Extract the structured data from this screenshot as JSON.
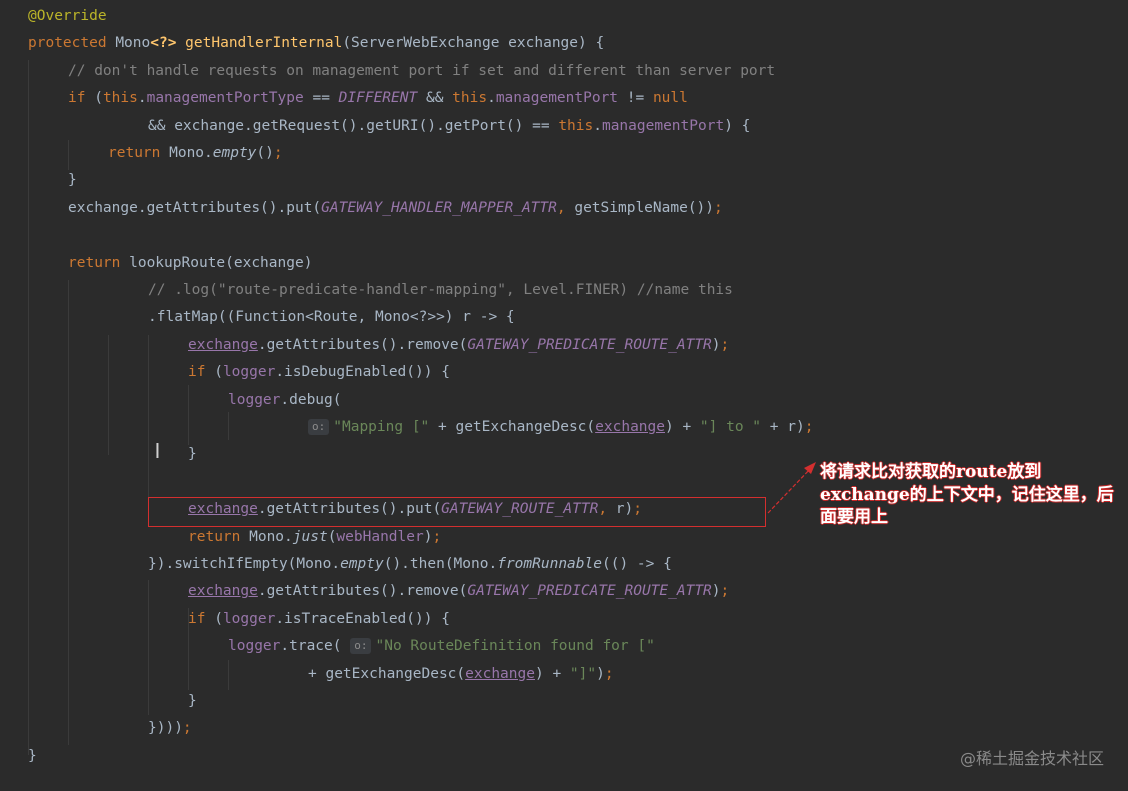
{
  "colors": {
    "background": "#2b2b2b",
    "keyword": "#cc7832",
    "plain": "#a9b7c6",
    "comment": "#808080",
    "string": "#6a8759",
    "field": "#9876aa",
    "method": "#ffc66d",
    "annotation": "#bbb529",
    "highlight_box": "#d32f2f"
  },
  "code_lines": [
    {
      "tokens": [
        {
          "t": "@Override",
          "c": "annotation"
        }
      ]
    },
    {
      "tokens": [
        {
          "t": "protected ",
          "c": "keyword"
        },
        {
          "t": "Mono",
          "c": "plain"
        },
        {
          "t": "<?>",
          "c": "brace"
        },
        {
          "t": " ",
          "c": "plain"
        },
        {
          "t": "getHandlerInternal",
          "c": "method"
        },
        {
          "t": "(ServerWebExchange exchange) {",
          "c": "plain"
        }
      ]
    },
    {
      "tokens": [
        {
          "t": "// don't handle requests on management port if set and different than server port",
          "c": "comment"
        }
      ]
    },
    {
      "tokens": [
        {
          "t": "if ",
          "c": "keyword"
        },
        {
          "t": "(",
          "c": "plain"
        },
        {
          "t": "this",
          "c": "keyword"
        },
        {
          "t": ".",
          "c": "plain"
        },
        {
          "t": "managementPortType",
          "c": "field"
        },
        {
          "t": " == ",
          "c": "plain"
        },
        {
          "t": "DIFFERENT",
          "c": "static"
        },
        {
          "t": " && ",
          "c": "plain"
        },
        {
          "t": "this",
          "c": "keyword"
        },
        {
          "t": ".",
          "c": "plain"
        },
        {
          "t": "managementPort",
          "c": "field"
        },
        {
          "t": " != ",
          "c": "plain"
        },
        {
          "t": "null",
          "c": "keyword"
        }
      ]
    },
    {
      "tokens": [
        {
          "t": "&& exchange.getRequest().getURI().getPort() == ",
          "c": "plain"
        },
        {
          "t": "this",
          "c": "keyword"
        },
        {
          "t": ".",
          "c": "plain"
        },
        {
          "t": "managementPort",
          "c": "field"
        },
        {
          "t": ") {",
          "c": "plain"
        }
      ]
    },
    {
      "tokens": [
        {
          "t": "return ",
          "c": "keyword"
        },
        {
          "t": "Mono.",
          "c": "plain"
        },
        {
          "t": "empty",
          "c": "italic"
        },
        {
          "t": "()",
          "c": "plain"
        },
        {
          "t": ";",
          "c": "keyword"
        }
      ]
    },
    {
      "tokens": [
        {
          "t": "}",
          "c": "plain"
        }
      ]
    },
    {
      "tokens": [
        {
          "t": "exchange.getAttributes().put(",
          "c": "plain"
        },
        {
          "t": "GATEWAY_HANDLER_MAPPER_ATTR",
          "c": "static"
        },
        {
          "t": ", ",
          "c": "keyword"
        },
        {
          "t": "getSimpleName())",
          "c": "plain"
        },
        {
          "t": ";",
          "c": "keyword"
        }
      ]
    },
    {
      "tokens": []
    },
    {
      "tokens": [
        {
          "t": "return ",
          "c": "keyword"
        },
        {
          "t": "lookupRoute(exchange)",
          "c": "plain"
        }
      ]
    },
    {
      "tokens": [
        {
          "t": "// .log(\"route-predicate-handler-mapping\", Level.FINER) //name this",
          "c": "comment"
        }
      ]
    },
    {
      "tokens": [
        {
          "t": ".flatMap((Function<Route, Mono<?>>) r -> {",
          "c": "plain"
        }
      ]
    },
    {
      "tokens": [
        {
          "t": "exchange",
          "c": "underline"
        },
        {
          "t": ".getAttributes().remove(",
          "c": "plain"
        },
        {
          "t": "GATEWAY_PREDICATE_ROUTE_ATTR",
          "c": "static"
        },
        {
          "t": ")",
          "c": "plain"
        },
        {
          "t": ";",
          "c": "keyword"
        }
      ]
    },
    {
      "tokens": [
        {
          "t": "if ",
          "c": "keyword"
        },
        {
          "t": "(",
          "c": "plain"
        },
        {
          "t": "logger",
          "c": "field"
        },
        {
          "t": ".isDebugEnabled()) {",
          "c": "plain"
        }
      ]
    },
    {
      "tokens": [
        {
          "t": "logger",
          "c": "field"
        },
        {
          "t": ".debug(",
          "c": "plain"
        }
      ]
    },
    {
      "tokens": [
        {
          "t": "o:",
          "c": "hint"
        },
        {
          "t": "\"Mapping [\"",
          "c": "string"
        },
        {
          "t": " + getExchangeDesc(",
          "c": "plain"
        },
        {
          "t": "exchange",
          "c": "underline"
        },
        {
          "t": ") + ",
          "c": "plain"
        },
        {
          "t": "\"] to \"",
          "c": "string"
        },
        {
          "t": " + r)",
          "c": "plain"
        },
        {
          "t": ";",
          "c": "keyword"
        }
      ]
    },
    {
      "tokens": [
        {
          "t": "}",
          "c": "plain"
        }
      ]
    },
    {
      "tokens": []
    },
    {
      "tokens": [
        {
          "t": "exchange",
          "c": "underline"
        },
        {
          "t": ".getAttributes().put(",
          "c": "plain"
        },
        {
          "t": "GATEWAY_ROUTE_ATTR",
          "c": "static"
        },
        {
          "t": ", ",
          "c": "keyword"
        },
        {
          "t": "r)",
          "c": "plain"
        },
        {
          "t": ";",
          "c": "keyword"
        }
      ]
    },
    {
      "tokens": [
        {
          "t": "return ",
          "c": "keyword"
        },
        {
          "t": "Mono.",
          "c": "plain"
        },
        {
          "t": "just",
          "c": "italic"
        },
        {
          "t": "(",
          "c": "plain"
        },
        {
          "t": "webHandler",
          "c": "field"
        },
        {
          "t": ")",
          "c": "plain"
        },
        {
          "t": ";",
          "c": "keyword"
        }
      ]
    },
    {
      "tokens": [
        {
          "t": "}).switchIfEmpty(Mono.",
          "c": "plain"
        },
        {
          "t": "empty",
          "c": "italic"
        },
        {
          "t": "().then(Mono.",
          "c": "plain"
        },
        {
          "t": "fromRunnable",
          "c": "italic"
        },
        {
          "t": "(() -> {",
          "c": "plain"
        }
      ]
    },
    {
      "tokens": [
        {
          "t": "exchange",
          "c": "underline"
        },
        {
          "t": ".getAttributes().remove(",
          "c": "plain"
        },
        {
          "t": "GATEWAY_PREDICATE_ROUTE_ATTR",
          "c": "static"
        },
        {
          "t": ")",
          "c": "plain"
        },
        {
          "t": ";",
          "c": "keyword"
        }
      ]
    },
    {
      "tokens": [
        {
          "t": "if ",
          "c": "keyword"
        },
        {
          "t": "(",
          "c": "plain"
        },
        {
          "t": "logger",
          "c": "field"
        },
        {
          "t": ".isTraceEnabled()) {",
          "c": "plain"
        }
      ]
    },
    {
      "tokens": [
        {
          "t": "logger",
          "c": "field"
        },
        {
          "t": ".trace( ",
          "c": "plain"
        },
        {
          "t": "o:",
          "c": "hint"
        },
        {
          "t": "\"No RouteDefinition found for [\"",
          "c": "string"
        }
      ]
    },
    {
      "tokens": [
        {
          "t": "+ getExchangeDesc(",
          "c": "plain"
        },
        {
          "t": "exchange",
          "c": "underline"
        },
        {
          "t": ") + ",
          "c": "plain"
        },
        {
          "t": "\"]\"",
          "c": "string"
        },
        {
          "t": ")",
          "c": "plain"
        },
        {
          "t": ";",
          "c": "keyword"
        }
      ]
    },
    {
      "tokens": [
        {
          "t": "}",
          "c": "plain"
        }
      ]
    },
    {
      "tokens": [
        {
          "t": "})))",
          "c": "plain"
        },
        {
          "t": ";",
          "c": "keyword"
        }
      ]
    },
    {
      "tokens": [
        {
          "t": "}",
          "c": "plain"
        }
      ]
    }
  ],
  "annotation_text": "将请求比对获取的route放到exchange的上下文中，记住这里，后面要用上",
  "watermark": "@稀土掘金技术社区"
}
